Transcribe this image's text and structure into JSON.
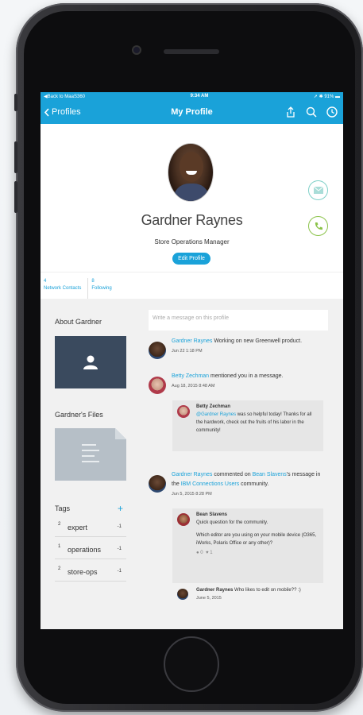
{
  "status_bar": {
    "back_app": "Back to MaaS360",
    "time": "9:34 AM",
    "battery": "91%"
  },
  "nav": {
    "back_label": "Profiles",
    "title": "My Profile",
    "icons": [
      "share-icon",
      "search-icon",
      "clock-icon"
    ]
  },
  "profile": {
    "name": "Gardner Raynes",
    "job_title": "Store Operations Manager",
    "edit_label": "Edit Profile",
    "stats": [
      {
        "count": "4",
        "label": "Network Contacts"
      },
      {
        "count": "8",
        "label": "Following"
      }
    ]
  },
  "left": {
    "about_title": "About Gardner",
    "files_title": "Gardner's Files",
    "tags_title": "Tags",
    "tags": [
      {
        "count": "2",
        "name": "expert",
        "action": "-1"
      },
      {
        "count": "1",
        "name": "operations",
        "action": "-1"
      },
      {
        "count": "2",
        "name": "store-ops",
        "action": "-1"
      }
    ]
  },
  "feed": {
    "input_placeholder": "Write a message on this profile",
    "items": [
      {
        "author": "Gardner Raynes",
        "text": "Working on new Greenwell product.",
        "time": "Jun 22 1:18 PM"
      },
      {
        "author": "Betty Zechman",
        "text": "mentioned you in a message.",
        "time": "Aug 18, 2015 8:48 AM",
        "quote": {
          "author": "Betty Zechman",
          "mention": "@Gardner Raynes",
          "text": "was so helpful today! Thanks for all the hardwork, check out the fruits of his labor in the community!"
        }
      },
      {
        "author": "Gardner Raynes",
        "text_a": "commented on",
        "link_a": "Bean Slavens",
        "text_b": "'s message in the",
        "link_b": "IBM Connections Users",
        "text_c": "community.",
        "time": "Jun 5, 2015 8:28 PM",
        "quote": {
          "author": "Bean Slavens",
          "line1": "Quick question for the community.",
          "line2": "Which editor are you using on your mobile device (O365, iWorks, Polaris Office or any other)?",
          "likes": "0",
          "hearts": "1"
        },
        "reply": {
          "author": "Gardner Raynes",
          "text": "Who likes to edit on mobile?? :)",
          "time": "June 5, 2015"
        }
      }
    ]
  },
  "colors": {
    "accent": "#1aa2d9",
    "call": "#8bc34a",
    "mail": "#7fd0c8"
  }
}
